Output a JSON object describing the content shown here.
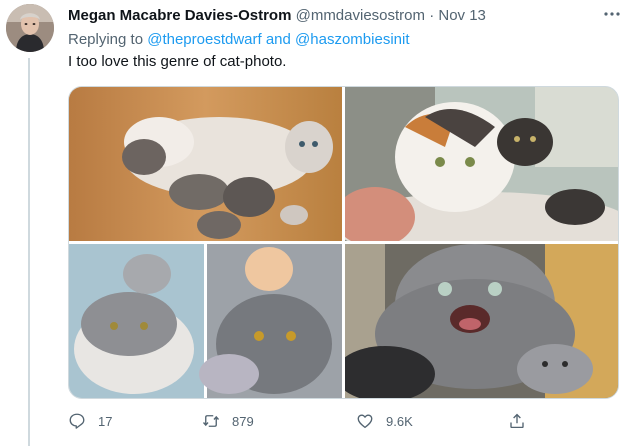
{
  "tweet": {
    "display_name": "Megan Macabre Davies-Ostrom",
    "handle": "@mmdaviesostrom",
    "separator": "·",
    "date": "Nov 13",
    "replying_prefix": "Replying to",
    "mention_1": "@theproestdwarf",
    "mention_and": "and",
    "mention_2": "@haszombiesinit",
    "text": "I too love this genre of cat-photo.",
    "more_icon": "more-dots-icon"
  },
  "media": {
    "photos": [
      {
        "name": "photo-top-left",
        "subject": "white cat lying with kittens on wooden floor"
      },
      {
        "name": "photo-top-right",
        "subject": "calico cat with kitten on its head"
      },
      {
        "name": "photo-bottom-left",
        "subject": "grey cats with kittens on their heads"
      },
      {
        "name": "photo-bottom-right",
        "subject": "grey cat hissing with kitten"
      }
    ]
  },
  "actions": {
    "reply": {
      "icon": "reply-icon",
      "count": "17"
    },
    "retweet": {
      "icon": "retweet-icon",
      "count": "879"
    },
    "like": {
      "icon": "heart-icon",
      "count": "9.6K"
    },
    "share": {
      "icon": "share-icon",
      "count": ""
    }
  },
  "colors": {
    "link": "#1d9bf0",
    "secondary_text": "#536471",
    "primary_text": "#0f1419",
    "divider": "#cfd9de"
  }
}
